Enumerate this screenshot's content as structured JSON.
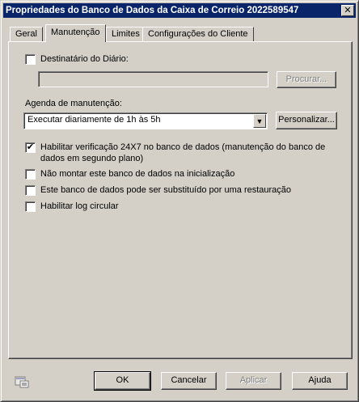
{
  "window": {
    "title": "Propriedades do Banco de Dados da Caixa de Correio 2022589547",
    "close_glyph": "✕"
  },
  "tabs": [
    {
      "label": "Geral",
      "active": false
    },
    {
      "label": "Manutenção",
      "active": true
    },
    {
      "label": "Limites",
      "active": false
    },
    {
      "label": "Configurações do Cliente",
      "active": false
    }
  ],
  "journal": {
    "checkbox_label": "Destinatário do Diário:",
    "checked": false,
    "value": "",
    "browse_label": "Procurar..."
  },
  "schedule": {
    "label": "Agenda de manutenção:",
    "selected": "Executar diariamente de 1h às 5h",
    "customize_label": "Personalizar..."
  },
  "options": [
    {
      "label": "Habilitar verificação 24X7 no banco de dados (manutenção do banco de dados em segundo plano)",
      "checked": true
    },
    {
      "label": "Não montar este banco de dados na inicialização",
      "checked": false
    },
    {
      "label": "Este banco de dados pode ser substituído por uma restauração",
      "checked": false
    },
    {
      "label": "Habilitar log circular",
      "checked": false
    }
  ],
  "footer": {
    "ok": "OK",
    "cancel": "Cancelar",
    "apply": "Aplicar",
    "help": "Ajuda"
  },
  "icons": {
    "help_icon": "help-topics-icon",
    "dropdown": "chevron-down-icon",
    "check": "✔"
  },
  "colors": {
    "title_bar": "#0a246a",
    "face": "#d4d0c8",
    "shadow": "#808080"
  }
}
